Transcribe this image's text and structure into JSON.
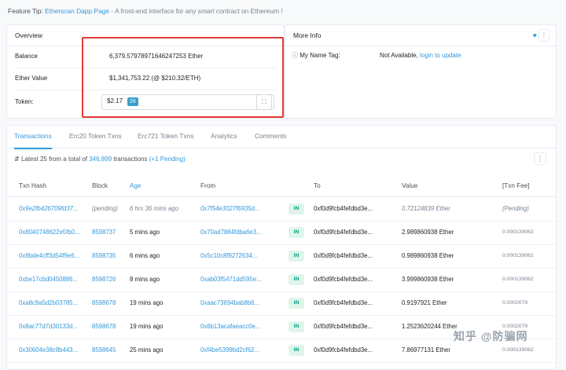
{
  "tip": {
    "prefix": "Feature Tip:",
    "link": "Etherscan Dapp Page",
    "text": " - A front-end interface for any smart contract on Ethereum !"
  },
  "overview": {
    "title": "Overview",
    "balance_label": "Balance",
    "balance_value": "6,379.57978971646247253 Ether",
    "ether_value_label": "Ether Value",
    "ether_value": "$1,341,753.22 (@ $210.32/ETH)",
    "token_label": "Token:",
    "token_value": "$2.17",
    "token_count": "26"
  },
  "more_info": {
    "title": "More Info",
    "name_tag_label": "My Name Tag:",
    "name_tag_value": "Not Available,",
    "name_tag_link": "login to update"
  },
  "tabs": [
    "Transactions",
    "Erc20 Token Txns",
    "Erc721 Token Txns",
    "Analytics",
    "Comments"
  ],
  "summary": {
    "prefix": "Latest 25 from a total of ",
    "total": "346,899",
    "middle": " transactions ",
    "pending": "(+1 Pending)"
  },
  "columns": [
    "Txn Hash",
    "Block",
    "Age",
    "From",
    "",
    "To",
    "Value",
    "[Txn Fee]"
  ],
  "rows": [
    {
      "hash": "0x9e2fb426709fd37...",
      "block": "(pending)",
      "age": "6 hrs 36 mins ago",
      "from": "0x7f54e3027f6935d...",
      "dir": "IN",
      "to": "0xf0d9fcb4fefdbd3e...",
      "value": "0.72124839 Ether",
      "fee": "(Pending)"
    },
    {
      "hash": "0x8040748622e5fb0...",
      "block": "8598737",
      "age": "5 mins ago",
      "from": "0x70ad7884fdba6e3...",
      "dir": "IN",
      "to": "0xf0d9fcb4fefdbd3e...",
      "value": "2.989860938 Ether",
      "fee": "0.000139062"
    },
    {
      "hash": "0x9bde4cff3d54f9e6...",
      "block": "8598735",
      "age": "6 mins ago",
      "from": "0x5c10c8f9272634...",
      "dir": "IN",
      "to": "0xf0d9fcb4fefdbd3e...",
      "value": "0.989860938 Ether",
      "fee": "0.000139062"
    },
    {
      "hash": "0xbe17cbd0450886...",
      "block": "8598726",
      "age": "8 mins ago",
      "from": "0xab03f5471dd595e...",
      "dir": "IN",
      "to": "0xf0d9fcb4fefdbd3e...",
      "value": "3.999860938 Ether",
      "fee": "0.000139062"
    },
    {
      "hash": "0xa8c9a5d2b03785...",
      "block": "8598678",
      "age": "19 mins ago",
      "from": "0xaac73694bab8b6...",
      "dir": "IN",
      "to": "0xf0d9fcb4fefdbd3e...",
      "value": "0.9197921 Ether",
      "fee": "0.0002079"
    },
    {
      "hash": "0x8ac77d7d30133d...",
      "block": "8598678",
      "age": "19 mins ago",
      "from": "0x6b13acafaeacc0e...",
      "dir": "IN",
      "to": "0xf0d9fcb4fefdbd3e...",
      "value": "1.2523620244 Ether",
      "fee": "0.0002079"
    },
    {
      "hash": "0x30604e38c8b443...",
      "block": "8598645",
      "age": "25 mins ago",
      "from": "0xf4be5399bd2cf62...",
      "dir": "IN",
      "to": "0xf0d9fcb4fefdbd3e...",
      "value": "7.86977131 Ether",
      "fee": "0.000139062"
    }
  ],
  "watermark": "知乎 @防骗网",
  "colors": {
    "link": "#3498db",
    "highlight": "#e53935",
    "in_badge": "#00a186"
  }
}
